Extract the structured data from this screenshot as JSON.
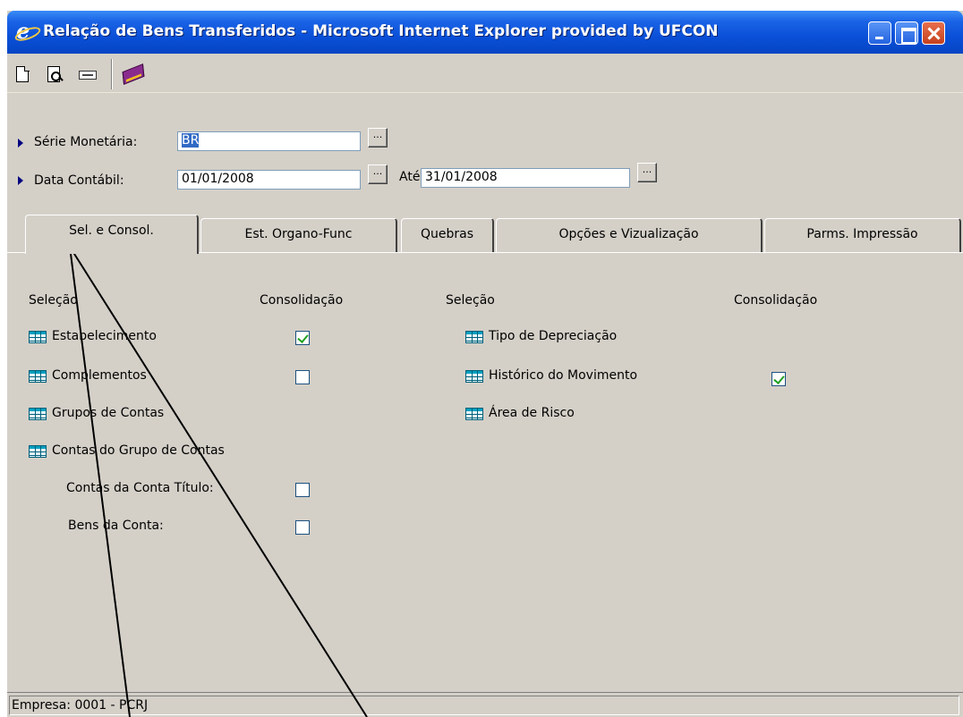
{
  "window": {
    "title": "Relação de Bens Transferidos - Microsoft Internet Explorer provided by UFCON",
    "controls": {
      "minimize": "minimize",
      "maximize": "maximize",
      "close": "close"
    }
  },
  "toolbar": {
    "icons": [
      "new-document-icon",
      "print-preview-icon",
      "printer-icon",
      "book-help-icon"
    ]
  },
  "filters": {
    "serie_label": "Série Monetária:",
    "serie_value": "BR",
    "data_label": "Data Contábil:",
    "data_from": "01/01/2008",
    "ate_label": "Até:",
    "data_to": "31/01/2008",
    "lookup_button": "..."
  },
  "tabs": [
    {
      "label": "Sel. e Consol.",
      "active": true
    },
    {
      "label": "Est. Organo-Func",
      "active": false
    },
    {
      "label": "Quebras",
      "active": false
    },
    {
      "label": "Opções e Vizualização",
      "active": false
    },
    {
      "label": "Parms. Impressão",
      "active": false
    }
  ],
  "panel": {
    "left": {
      "selecao_header": "Seleção",
      "consolidacao_header": "Consolidação",
      "items": [
        {
          "label": "Estabelecimento",
          "checked": true
        },
        {
          "label": "Complementos",
          "checked": false
        },
        {
          "label": "Grupos de Contas"
        },
        {
          "label": "Contas do Grupo de Contas"
        }
      ],
      "subitems": [
        {
          "label": "Contas da Conta Título:",
          "checked": false
        },
        {
          "label": "Bens da Conta:",
          "checked": false
        }
      ]
    },
    "right": {
      "selecao_header": "Seleção",
      "consolidacao_header": "Consolidação",
      "items": [
        {
          "label": "Tipo de Depreciação"
        },
        {
          "label": "Histórico do Movimento",
          "checked": true
        },
        {
          "label": "Área de Risco"
        }
      ]
    }
  },
  "status": {
    "text": "Empresa: 0001 - PCRJ"
  },
  "colors": {
    "window_bg": "#d4d0c8",
    "titlebar": "#0a50d8",
    "checkmark": "#21a121",
    "selection": "#316ac5"
  }
}
